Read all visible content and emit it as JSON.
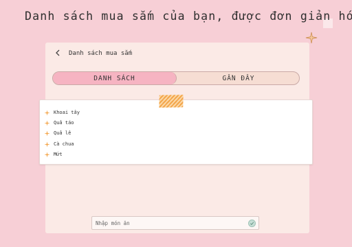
{
  "headline": "Danh sách mua sắm của bạn, được đơn giản hóa",
  "nav": {
    "back_icon": "chevron-left",
    "title": "Danh sách mua sắm"
  },
  "tabs": [
    {
      "label": "DANH SÁCH",
      "active": true
    },
    {
      "label": "GẦN ĐÂY",
      "active": false
    }
  ],
  "list": {
    "bullet_icon": "sparkle",
    "items": [
      "Khoai tây",
      "Quả táo",
      "Quả lê",
      "Cà chua",
      "Mứt"
    ]
  },
  "input": {
    "placeholder": "Nhập món ăn",
    "value": "",
    "submit_icon": "check-circle"
  },
  "colors": {
    "background": "#f7cfd6",
    "card": "#fbeae6",
    "tab_active": "#f6b4c2",
    "tab_inactive": "#f6ddd3",
    "accent_orange": "#f3a64b",
    "submit_green": "#c5ded5"
  }
}
